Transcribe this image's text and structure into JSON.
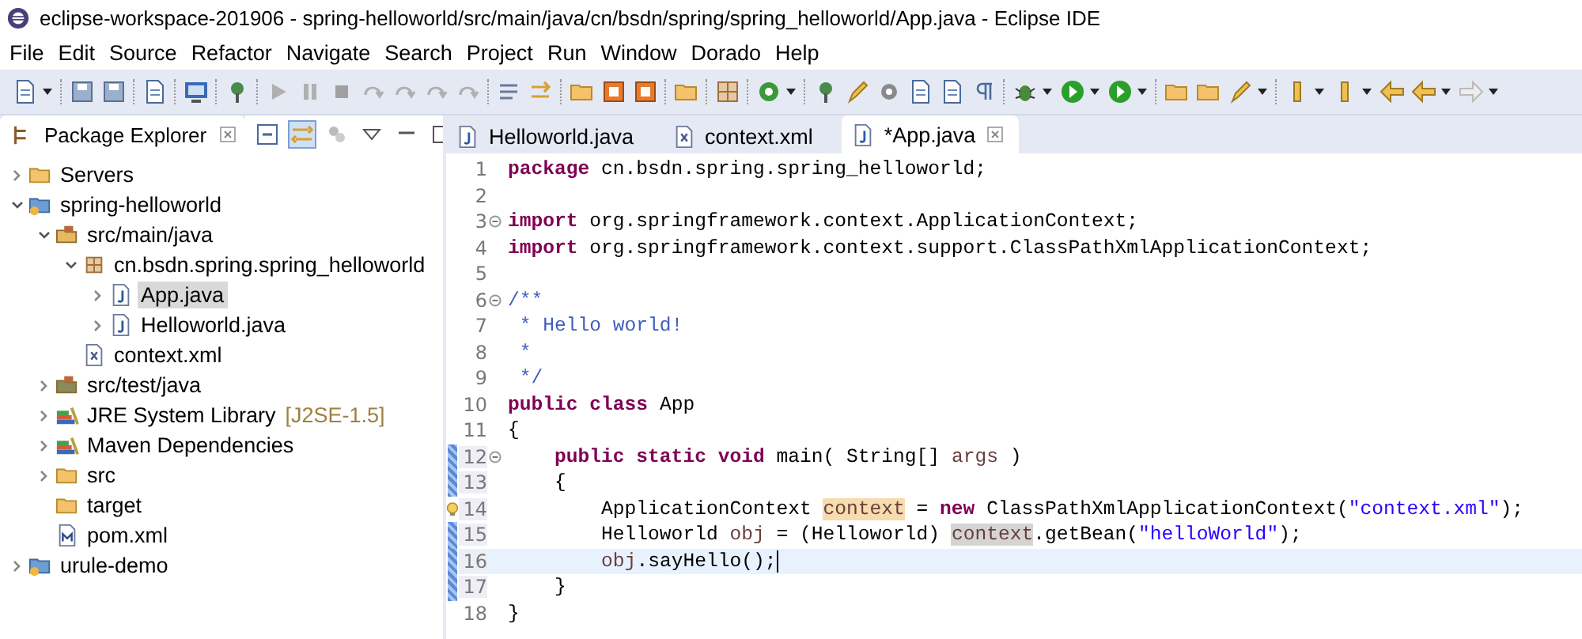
{
  "window": {
    "title": "eclipse-workspace-201906 - spring-helloworld/src/main/java/cn/bsdn/spring/spring_helloworld/App.java - Eclipse IDE"
  },
  "menu": [
    "File",
    "Edit",
    "Source",
    "Refactor",
    "Navigate",
    "Search",
    "Project",
    "Run",
    "Window",
    "Dorado",
    "Help"
  ],
  "explorer": {
    "title": "Package Explorer",
    "items": [
      {
        "label": "Servers",
        "kind": "folder",
        "expanded": false,
        "selected": false
      },
      {
        "label": "spring-helloworld",
        "kind": "project",
        "expanded": true,
        "selected": false,
        "children": [
          {
            "label": "src/main/java",
            "kind": "source",
            "expanded": true,
            "selected": false,
            "children": [
              {
                "label": "cn.bsdn.spring.spring_helloworld",
                "kind": "package",
                "expanded": true,
                "selected": false,
                "children": [
                  {
                    "label": "App.java",
                    "kind": "java",
                    "expanded": false,
                    "selected": true
                  },
                  {
                    "label": "Helloworld.java",
                    "kind": "java",
                    "expanded": false,
                    "selected": false
                  }
                ]
              },
              {
                "label": "context.xml",
                "kind": "xml",
                "selected": false
              }
            ]
          },
          {
            "label": "src/test/java",
            "kind": "testsource",
            "expanded": false,
            "selected": false
          },
          {
            "label": "JRE System Library",
            "suffix": "[J2SE-1.5]",
            "kind": "library",
            "expanded": false,
            "selected": false
          },
          {
            "label": "Maven Dependencies",
            "kind": "library",
            "expanded": false,
            "selected": false
          },
          {
            "label": "src",
            "kind": "folder",
            "expanded": false,
            "selected": false
          },
          {
            "label": "target",
            "kind": "folder",
            "selected": false
          },
          {
            "label": "pom.xml",
            "kind": "pom",
            "selected": false
          }
        ]
      },
      {
        "label": "urule-demo",
        "kind": "project",
        "expanded": false,
        "selected": false
      }
    ]
  },
  "editor": {
    "tabs": [
      {
        "label": "Helloworld.java",
        "kind": "java",
        "selected": false
      },
      {
        "label": "context.xml",
        "kind": "xml",
        "selected": false
      },
      {
        "label": "*App.java",
        "kind": "java",
        "selected": true
      }
    ],
    "lines": [
      {
        "number": "1",
        "tokens": [
          {
            "kind": "kw",
            "text": "package"
          },
          {
            "kind": "plain",
            "text": " cn.bsdn.spring.spring_helloworld;"
          }
        ]
      },
      {
        "number": "2"
      },
      {
        "number": "3",
        "fold": true,
        "tokens": [
          {
            "kind": "kw",
            "text": "import"
          },
          {
            "kind": "plain",
            "text": " org.springframework.context.ApplicationContext;"
          }
        ]
      },
      {
        "number": "4",
        "tokens": [
          {
            "kind": "kw",
            "text": "import"
          },
          {
            "kind": "plain",
            "text": " org.springframework.context.support.ClassPathXmlApplicationContext;"
          }
        ]
      },
      {
        "number": "5"
      },
      {
        "number": "6",
        "fold": true,
        "tokens": [
          {
            "kind": "comment",
            "text": "/**"
          }
        ]
      },
      {
        "number": "7",
        "tokens": [
          {
            "kind": "comment",
            "text": " * Hello world!"
          }
        ]
      },
      {
        "number": "8",
        "tokens": [
          {
            "kind": "comment",
            "text": " *"
          }
        ]
      },
      {
        "number": "9",
        "tokens": [
          {
            "kind": "comment",
            "text": " */"
          }
        ]
      },
      {
        "number": "10",
        "tokens": [
          {
            "kind": "kw",
            "text": "public class"
          },
          {
            "kind": "plain",
            "text": " App"
          }
        ]
      },
      {
        "number": "11",
        "tokens": [
          {
            "kind": "plain",
            "text": "{"
          }
        ]
      },
      {
        "number": "12",
        "fold": true,
        "changed": true,
        "tokens": [
          {
            "kind": "kw",
            "text": "    public static void"
          },
          {
            "kind": "plain",
            "text": " main( String[] "
          },
          {
            "kind": "var",
            "text": "args"
          },
          {
            "kind": "plain",
            "text": " )"
          }
        ]
      },
      {
        "number": "13",
        "changed": true,
        "tokens": [
          {
            "kind": "plain",
            "text": "    {"
          }
        ]
      },
      {
        "number": "14",
        "quickfix": true,
        "tokens": [
          {
            "kind": "plain",
            "text": "        ApplicationContext "
          },
          {
            "kind": "var_write",
            "text": "context"
          },
          {
            "kind": "plain",
            "text": " = "
          },
          {
            "kind": "kw",
            "text": "new"
          },
          {
            "kind": "plain",
            "text": " ClassPathXmlApplicationContext("
          },
          {
            "kind": "string",
            "text": "\"context.xml\""
          },
          {
            "kind": "plain",
            "text": ");"
          }
        ]
      },
      {
        "number": "15",
        "changed": true,
        "tokens": [
          {
            "kind": "plain",
            "text": "        Helloworld "
          },
          {
            "kind": "var",
            "text": "obj"
          },
          {
            "kind": "plain",
            "text": " = (Helloworld) "
          },
          {
            "kind": "var_read",
            "text": "context"
          },
          {
            "kind": "plain",
            "text": ".getBean("
          },
          {
            "kind": "string",
            "text": "\"helloWorld\""
          },
          {
            "kind": "plain",
            "text": ");"
          }
        ]
      },
      {
        "number": "16",
        "changed": true,
        "current": true,
        "tokens": [
          {
            "kind": "var",
            "text": "        obj"
          },
          {
            "kind": "plain",
            "text": ".sayHello();"
          }
        ]
      },
      {
        "number": "17",
        "changed": true,
        "tokens": [
          {
            "kind": "plain",
            "text": "    }"
          }
        ]
      },
      {
        "number": "18",
        "tokens": [
          {
            "kind": "plain",
            "text": "}"
          }
        ]
      }
    ]
  }
}
